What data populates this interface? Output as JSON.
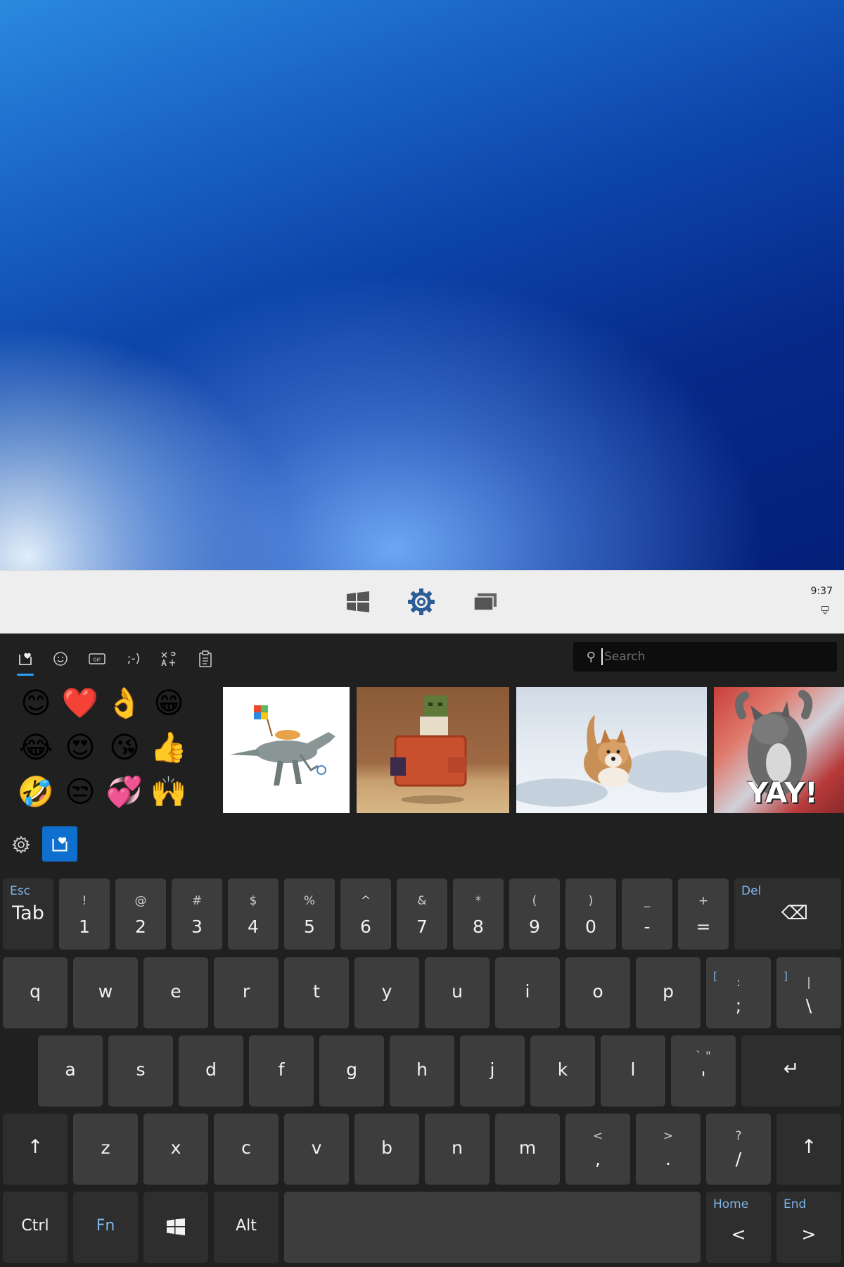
{
  "taskbar": {
    "clock": "9:37",
    "icons": [
      "windows-start-icon",
      "settings-gear-icon",
      "task-view-icon"
    ]
  },
  "picker": {
    "tabs": [
      {
        "name": "favorites",
        "icon": "heart-card-icon",
        "active": true
      },
      {
        "name": "emoji",
        "icon": "smiley-icon"
      },
      {
        "name": "gif",
        "icon": "gif-icon",
        "label": "GIF"
      },
      {
        "name": "kaomoji",
        "label": ";-)"
      },
      {
        "name": "symbols",
        "icon": "symbols-icon"
      },
      {
        "name": "clipboard",
        "icon": "clipboard-icon"
      }
    ],
    "search_placeholder": "Search",
    "emojis": [
      "😊",
      "❤️",
      "👌",
      "😁",
      "😂",
      "😍",
      "😘",
      "👍",
      "🤣",
      "😒",
      "💞",
      "🙌"
    ],
    "gifs": [
      {
        "name": "dinosaur-windows-flag-gif"
      },
      {
        "name": "minecraft-character-gif"
      },
      {
        "name": "corgi-snow-gif"
      },
      {
        "name": "cat-yay-gif",
        "caption": "YAY!"
      }
    ]
  },
  "keyboard": {
    "row1": [
      {
        "main": "Tab",
        "alt": "Esc"
      },
      {
        "shift": "!",
        "main": "1"
      },
      {
        "shift": "@",
        "main": "2"
      },
      {
        "shift": "#",
        "main": "3"
      },
      {
        "shift": "$",
        "main": "4"
      },
      {
        "shift": "%",
        "main": "5"
      },
      {
        "shift": "^",
        "main": "6"
      },
      {
        "shift": "&",
        "main": "7"
      },
      {
        "shift": "*",
        "main": "8"
      },
      {
        "shift": "(",
        "main": "9"
      },
      {
        "shift": ")",
        "main": "0"
      },
      {
        "shift": "_",
        "main": "-"
      },
      {
        "shift": "+",
        "main": "="
      },
      {
        "alt": "Del",
        "main": "⌫"
      }
    ],
    "row2": [
      {
        "main": "q"
      },
      {
        "main": "w"
      },
      {
        "main": "e"
      },
      {
        "main": "r"
      },
      {
        "main": "t"
      },
      {
        "main": "y"
      },
      {
        "main": "u"
      },
      {
        "main": "i"
      },
      {
        "main": "o"
      },
      {
        "main": "p"
      },
      {
        "alt": "[",
        "shift": ":",
        "main": ";"
      },
      {
        "alt": "]",
        "shift": "|",
        "main": "\\"
      }
    ],
    "row3": [
      {
        "main": "a"
      },
      {
        "main": "s"
      },
      {
        "main": "d"
      },
      {
        "main": "f"
      },
      {
        "main": "g"
      },
      {
        "main": "h"
      },
      {
        "main": "j"
      },
      {
        "main": "k"
      },
      {
        "main": "l"
      },
      {
        "shift": "` \"",
        "main": "'"
      },
      {
        "main": "↵"
      }
    ],
    "row4": [
      {
        "main": "↑"
      },
      {
        "main": "z"
      },
      {
        "main": "x"
      },
      {
        "main": "c"
      },
      {
        "main": "v"
      },
      {
        "main": "b"
      },
      {
        "main": "n"
      },
      {
        "main": "m"
      },
      {
        "shift": "<",
        "main": ","
      },
      {
        "shift": ">",
        "main": "."
      },
      {
        "shift": "?",
        "main": "/"
      },
      {
        "main": "↑"
      }
    ],
    "row5": [
      {
        "main": "Ctrl"
      },
      {
        "main": "Fn"
      },
      {
        "main": "windows-key-icon"
      },
      {
        "main": "Alt"
      },
      {
        "main": ""
      },
      {
        "alt": "Home",
        "main": "<"
      },
      {
        "alt": "End",
        "main": ">"
      }
    ]
  }
}
